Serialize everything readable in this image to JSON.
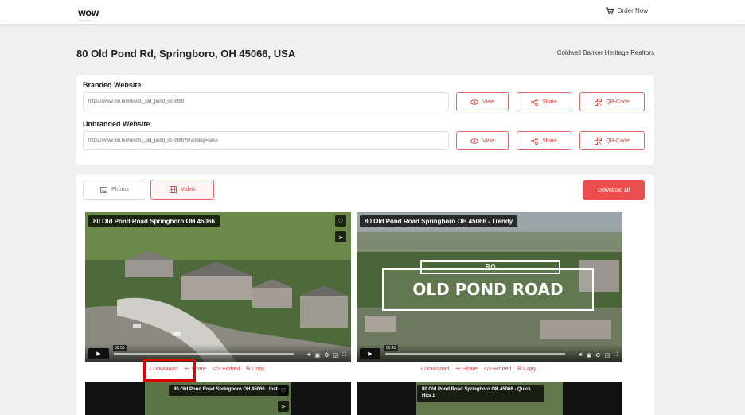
{
  "header": {
    "logo_main": "WOW",
    "logo_sub": "video tours",
    "order_label": "Order Now"
  },
  "property": {
    "address": "80 Old Pond Rd, Springboro, OH 45066, USA",
    "agency": "Coldwell Banker Heritage Realtors"
  },
  "branded": {
    "label": "Branded Website",
    "url": "https://www.vid.homes/80_old_pond_rd-6988"
  },
  "unbranded": {
    "label": "Unbranded Website",
    "url": "https://www.vid.homes/80_old_pond_rd-6988?branding=false"
  },
  "buttons": {
    "view": "View",
    "share": "Share",
    "qr": "QR-Code",
    "download_all": "Download all"
  },
  "tabs": {
    "photos": "Photos",
    "video": "Video"
  },
  "videos": [
    {
      "title": "80 Old Pond Road Springboro OH 45066",
      "time": "00:55"
    },
    {
      "title": "80 Old Pond Road Springboro OH 45066 - Trendy",
      "time": "00:43",
      "overlay_number": "80",
      "overlay_street": "OLD POND ROAD"
    },
    {
      "title": "80 Old Pond Road Springboro OH 45066 - Insta"
    },
    {
      "title": "80 Old Pond Road Springboro OH 45066 - Quick Hits 1"
    }
  ],
  "actions": {
    "download": "Download",
    "share": "Share",
    "embed": "Embed",
    "copy": "Copy"
  },
  "colors": {
    "accent": "#e94d4d",
    "accent_text": "#d84040"
  }
}
